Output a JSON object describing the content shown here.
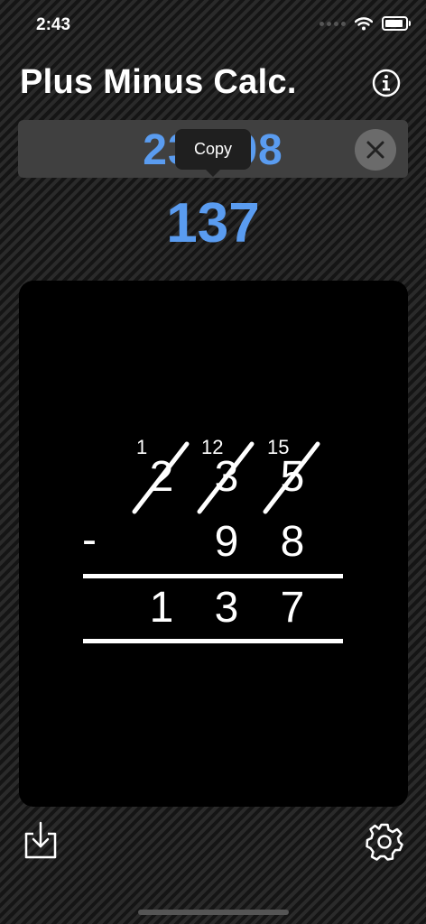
{
  "status_bar": {
    "time": "2:43"
  },
  "header": {
    "title": "Plus Minus Calc."
  },
  "input": {
    "expression": "235-98"
  },
  "tooltip": {
    "label": "Copy"
  },
  "result": {
    "value": "137"
  },
  "work": {
    "top_digits": [
      "2",
      "3",
      "5"
    ],
    "borrow_marks": [
      "1",
      "12",
      "15"
    ],
    "operator": "-",
    "subtrahend_digits": [
      "9",
      "8"
    ],
    "answer_digits": [
      "1",
      "3",
      "7"
    ]
  },
  "icons": {
    "info": "info-icon",
    "clear": "close-icon",
    "import": "import-icon",
    "settings": "gear-icon"
  },
  "colors": {
    "accent": "#5a9cf0",
    "panel": "#000000",
    "input_bar": "#404040",
    "clear_button": "#6b6b6b"
  }
}
